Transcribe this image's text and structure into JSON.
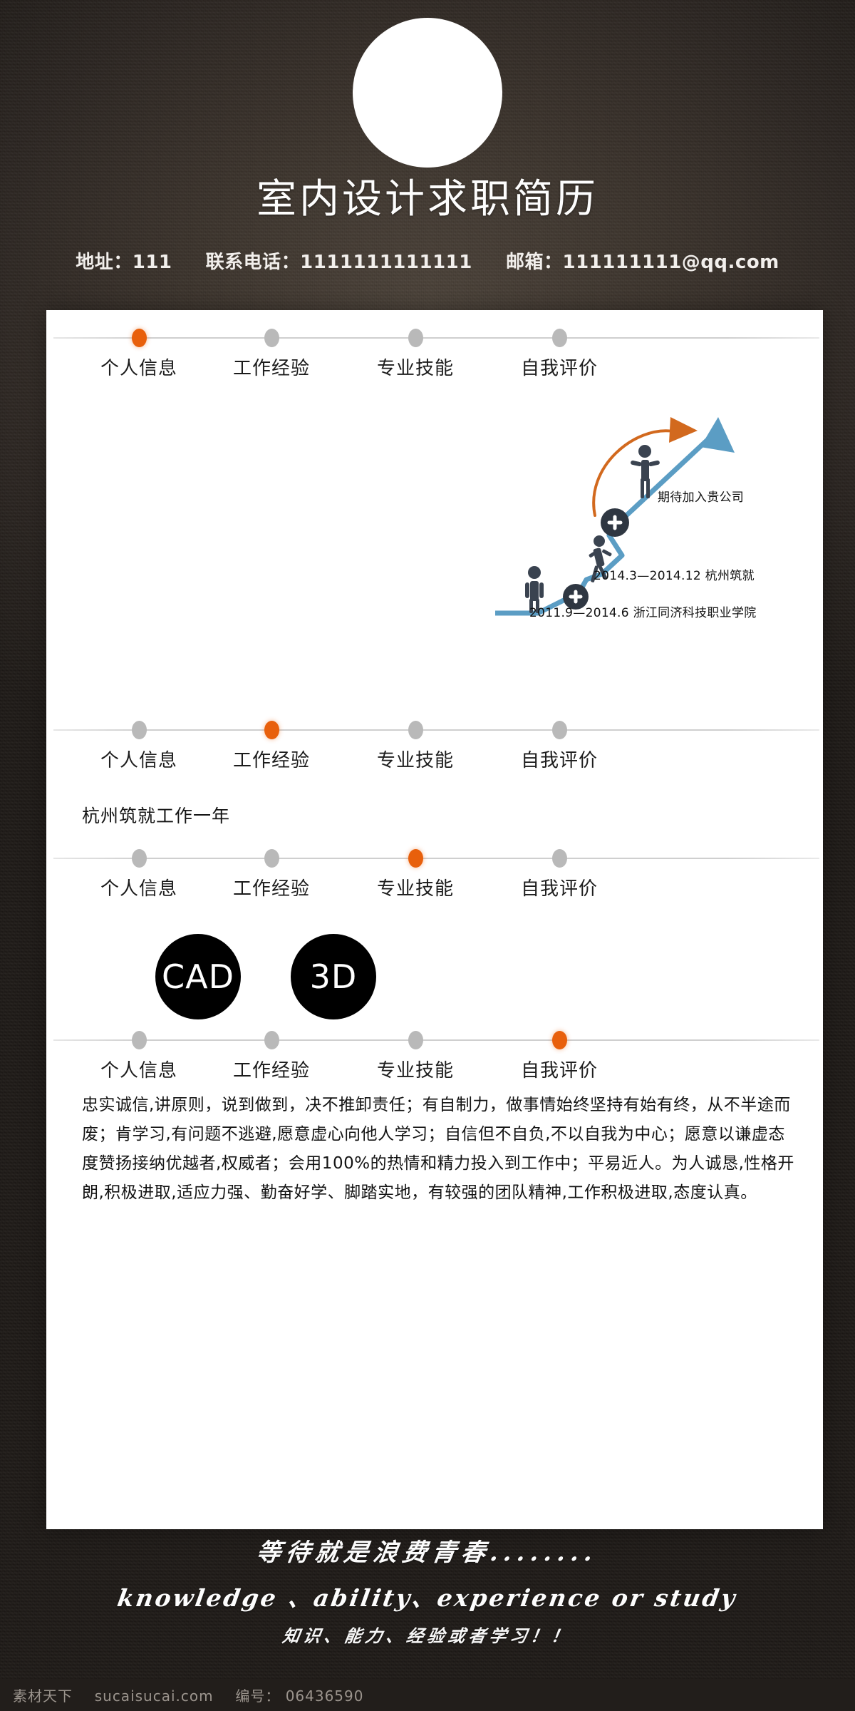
{
  "header": {
    "title": "室内设计求职简历",
    "contact": {
      "address_label": "地址：",
      "address_value": "111",
      "phone_label": "联系电话：",
      "phone_value": "1111111111111",
      "email_label": "邮箱：",
      "email_value": "111111111@qq.com"
    }
  },
  "colors": {
    "accent": "#e8600c",
    "inactive_dot": "#b9b9b9",
    "paper": "#ffffff",
    "background": "#2b2521",
    "path_blue": "#5b9dc4",
    "arrow_orange": "#d2691e",
    "pictogram": "#3a4350"
  },
  "nav": {
    "items": [
      {
        "label": "个人信息"
      },
      {
        "label": "工作经验"
      },
      {
        "label": "专业技能"
      },
      {
        "label": "自我评价"
      }
    ],
    "rows": [
      {
        "active_index": 0
      },
      {
        "active_index": 1
      },
      {
        "active_index": 2
      },
      {
        "active_index": 3
      }
    ]
  },
  "section_personal": {
    "caption_top": "期待加入贵公司",
    "caption_mid": "2014.3—2014.12 杭州筑就",
    "caption_bottom": "2011.9—2014.6 浙江同济科技职业学院"
  },
  "section_work": {
    "text": "杭州筑就工作一年"
  },
  "section_skills": {
    "items": [
      {
        "label": "CAD"
      },
      {
        "label": "3D"
      }
    ]
  },
  "section_evaluation": {
    "text": "忠实诚信,讲原则，说到做到，决不推卸责任；有自制力，做事情始终坚持有始有终，从不半途而废；肯学习,有问题不逃避,愿意虚心向他人学习；自信但不自负,不以自我为中心；愿意以谦虚态度赞扬接纳优越者,权威者；会用100%的热情和精力投入到工作中；平易近人。为人诚恳,性格开朗,积极进取,适应力强、勤奋好学、脚踏实地，有较强的团队精神,工作积极进取,态度认真。"
  },
  "footer": {
    "slogan_cn": "等待就是浪费青春........",
    "slogan_en": "knowledge 、ability、experience or study",
    "slogan_cn2": "知识、能力、经验或者学习！！"
  },
  "watermark": {
    "site_cn": "素材天下",
    "site_url": "sucaisucai.com",
    "id_label": "编号：",
    "id_value": "06436590"
  }
}
